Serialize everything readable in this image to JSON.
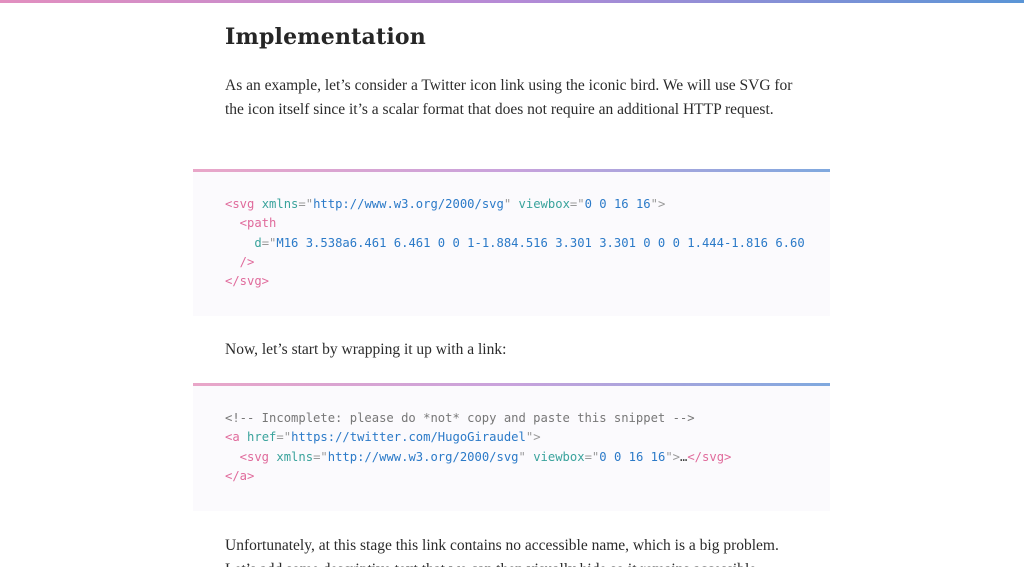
{
  "colors": {
    "accent_gradient_start": "#e28fbf",
    "accent_gradient_end": "#5a95d6",
    "tag": "#e06a9b",
    "attribute": "#3aa39c",
    "string": "#2b7ac8",
    "comment": "#777777"
  },
  "article": {
    "heading": "Implementation",
    "paragraphs": [
      "As an example, let’s consider a Twitter icon link using the iconic bird. We will use SVG for the icon itself since it’s a scalar format that does not require an additional HTTP request.",
      "Now, let’s start by wrapping it up with a link:",
      "Unfortunately, at this stage this link contains no accessible name, which is a big problem.",
      "Let’s add some descriptive text that we can then visually hide so it remains accessible."
    ],
    "code_blocks": [
      {
        "lines": {
          "l1_open": "<svg",
          "l1_attr1": " xmlns",
          "l1_eq1": "=\"",
          "l1_val1": "http://www.w3.org/2000/svg",
          "l1_q1": "\"",
          "l1_attr2": " viewbox",
          "l1_eq2": "=\"",
          "l1_val2": "0 0 16 16",
          "l1_close": "\">",
          "l2_open": "  <path",
          "l3_attr": "    d",
          "l3_eq": "=\"",
          "l3_val": "M16 3.538a6.461 6.461 0 0 1-1.884.516 3.301 3.301 0 0 0 1.444-1.816 6.60",
          "l4": "  />",
          "l5": "</svg>"
        }
      },
      {
        "lines": {
          "l1_comment": "<!-- Incomplete: please do *not* copy and paste this snippet -->",
          "l2_open": "<a",
          "l2_attr": " href",
          "l2_eq": "=\"",
          "l2_val": "https://twitter.com/HugoGiraudel",
          "l2_close": "\">",
          "l3_open": "  <svg",
          "l3_attr1": " xmlns",
          "l3_eq1": "=\"",
          "l3_val1": "http://www.w3.org/2000/svg",
          "l3_q1": "\"",
          "l3_attr2": " viewbox",
          "l3_eq2": "=\"",
          "l3_val2": "0 0 16 16",
          "l3_q2": "\">",
          "l3_ellipsis": "…",
          "l3_end": "</svg>",
          "l4": "</a>"
        }
      }
    ]
  }
}
